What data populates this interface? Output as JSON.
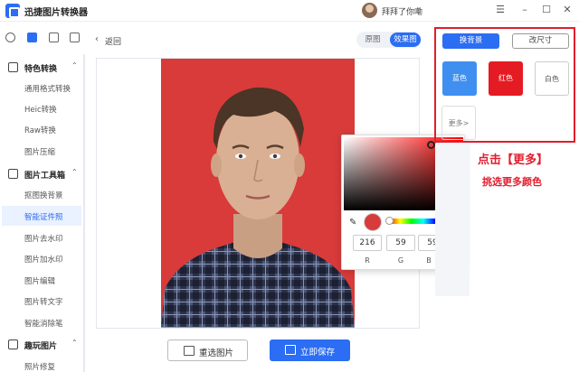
{
  "app": {
    "title": "迅捷图片转换器",
    "username": "拜拜了你嘞"
  },
  "window_controls": [
    "menu-icon",
    "minimize-icon",
    "maximize-icon",
    "close-icon"
  ],
  "sidebar": {
    "sections": [
      {
        "label": "特色转换",
        "items": [
          "通用格式转换",
          "Heic转换",
          "Raw转换",
          "图片压缩"
        ]
      },
      {
        "label": "图片工具箱",
        "items": [
          "抠图换背景",
          "智能证件照",
          "图片去水印",
          "图片加水印",
          "图片编辑",
          "图片转文字",
          "智能消除笔"
        ]
      },
      {
        "label": "趣玩图片",
        "items": [
          "照片修复"
        ]
      }
    ],
    "active_item": "智能证件照"
  },
  "main": {
    "back_label": "返回",
    "view_toggle": {
      "original": "原图",
      "effect": "效果图",
      "selected": "效果图"
    }
  },
  "color_picker": {
    "current_color": "#d83b3b",
    "r": "216",
    "g": "59",
    "b": "59",
    "labels": {
      "r": "R",
      "g": "G",
      "b": "B"
    },
    "mode_switch": "⌄"
  },
  "right_panel": {
    "tabs": {
      "recommended": "换背景",
      "resize": "改尺寸"
    },
    "colors": [
      {
        "label": "蓝色",
        "hex": "#3f8ff0"
      },
      {
        "label": "红色",
        "hex": "#e51b23"
      },
      {
        "label": "白色",
        "hex": "#ffffff"
      }
    ],
    "more_label": "更多>"
  },
  "callout": {
    "line1": "点击【更多】",
    "line2": "挑选更多颜色"
  },
  "bottom": {
    "reselect_label": "重选图片",
    "save_label": "立即保存"
  }
}
